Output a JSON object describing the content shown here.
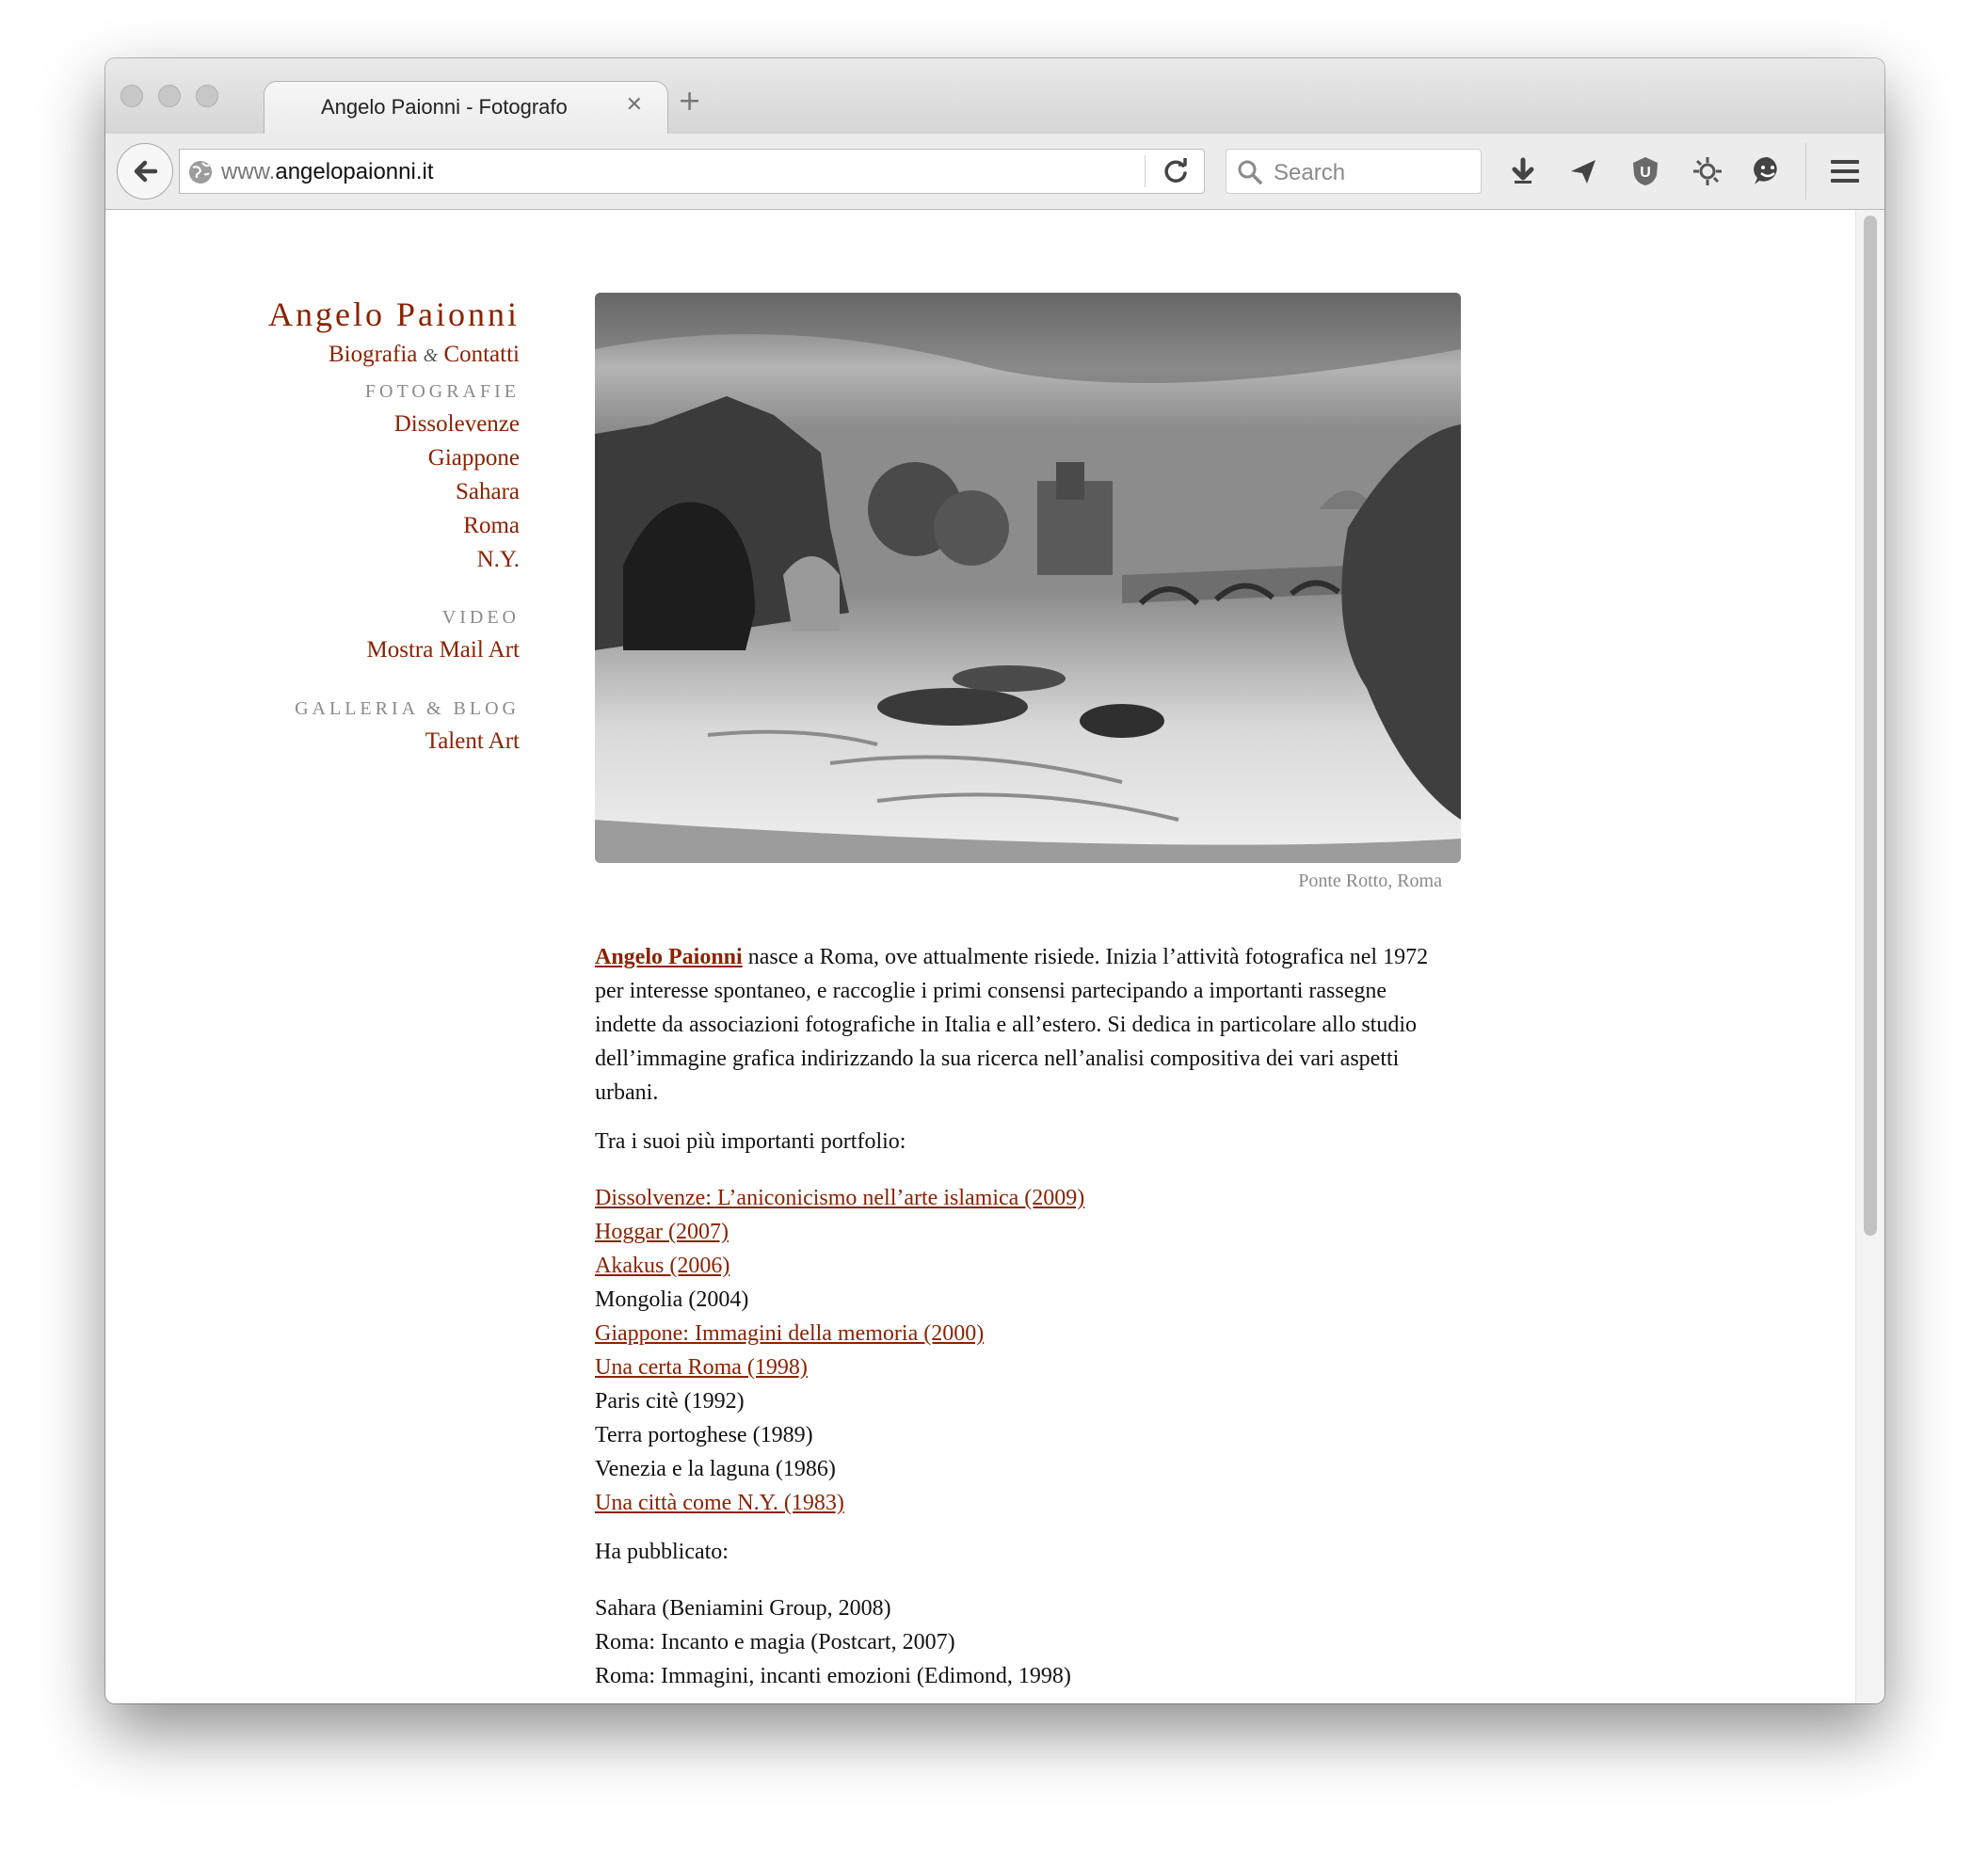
{
  "browser": {
    "tab_title": "Angelo Paionni - Fotografo",
    "url_prefix": "www.",
    "url_domain": "angelopaionni.it",
    "search_placeholder": "Search"
  },
  "sidebar": {
    "site_title": "Angelo Paionni",
    "bio_link": "Biografia",
    "bio_amp": "&",
    "contacts_link": "Contatti",
    "fotografie_heading": "FOTOGRAFIE",
    "fotografie_items": [
      "Dissolevenze",
      "Giappone",
      "Sahara",
      "Roma",
      "N.Y."
    ],
    "video_heading": "VIDEO",
    "video_items": [
      "Mostra Mail Art"
    ],
    "galleria_heading": "GALLERIA & BLOG",
    "galleria_items": [
      "Talent Art"
    ]
  },
  "main": {
    "photo_caption": "Ponte Rotto, Roma",
    "intro_name": "Angelo Paionni",
    "intro_text": " nasce a Roma, ove attualmente risiede. Inizia l’attività fotografica nel 1972 per interesse spontaneo, e raccoglie i primi consensi partecipando a importanti rassegne indette da associazioni fotografiche in Italia e all’estero. Si dedica in particolare allo studio dell’immagine grafica indirizzando la sua ricerca nell’analisi compositiva dei vari aspetti urbani.",
    "portfolio_heading": "Tra i suoi più importanti portfolio:",
    "portfolio": [
      {
        "label": "Dissolvenze: L’aniconicismo nell’arte islamica (2009)",
        "link": true
      },
      {
        "label": "Hoggar (2007)",
        "link": true
      },
      {
        "label": "Akakus (2006)",
        "link": true
      },
      {
        "label": "Mongolia (2004)",
        "link": false
      },
      {
        "label": "Giappone: Immagini della memoria (2000)",
        "link": true
      },
      {
        "label": "Una certa Roma (1998)",
        "link": true
      },
      {
        "label": "Paris citè (1992)",
        "link": false
      },
      {
        "label": "Terra portoghese (1989)",
        "link": false
      },
      {
        "label": "Venezia e la laguna (1986)",
        "link": false
      },
      {
        "label": "Una città come N.Y. (1983)",
        "link": true
      }
    ],
    "published_heading": "Ha pubblicato:",
    "published": [
      "Sahara (Beniamini Group, 2008)",
      "Roma: Incanto e magia (Postcart, 2007)",
      "Roma: Immagini, incanti emozioni (Edimond, 1998)"
    ]
  }
}
